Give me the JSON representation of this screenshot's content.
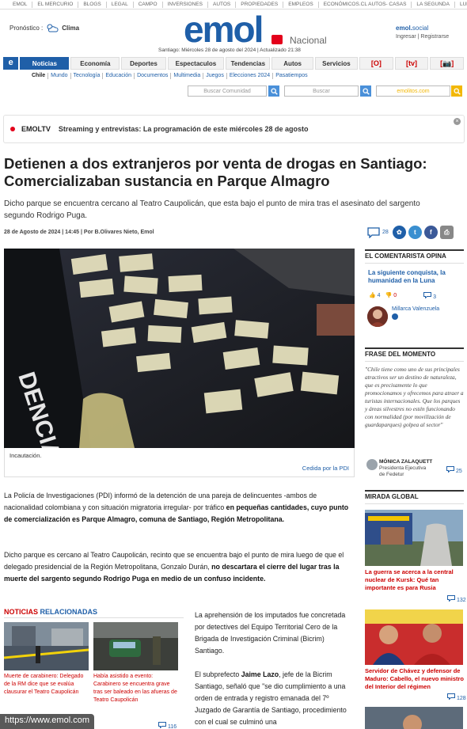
{
  "top_links": [
    "EMOL",
    "EL MERCURIO",
    "BLOGS",
    "LEGAL",
    "CAMPO",
    "INVERSIONES",
    "AUTOS",
    "PROPIEDADES",
    "EMPLEOS",
    "ECONÓMICOS.CL AUTOS- CASAS",
    "LA SEGUNDA",
    "LUN"
  ],
  "header": {
    "forecast_label": "Pronóstico :",
    "forecast_link": "Clima",
    "logo": "emol",
    "section": "Nacional",
    "dateline": "Santiago: Miércoles 28 de agosto del 2024 | Actualizado 21:38",
    "social_brand": "emol.",
    "social_word": "social",
    "login": "Ingresar | Registrarse"
  },
  "nav": {
    "tabs": [
      "Noticias",
      "Economía",
      "Deportes",
      "Espectaculos",
      "Tendencias",
      "Autos",
      "Servicios"
    ],
    "icon_tabs": [
      "[O]",
      "[tv]",
      "[📷]"
    ],
    "subnav": [
      "Chile",
      "Mundo",
      "Tecnología",
      "Educación",
      "Documentos",
      "Multimedia",
      "Juegos",
      "Elecciones 2024",
      "Pasatiempos"
    ]
  },
  "search": {
    "community_placeholder": "Buscar Comunidad",
    "news_placeholder": "Buscar",
    "brand_placeholder": "emolitos.com"
  },
  "banner": {
    "label": "EMOLTV",
    "text": "Streaming y entrevistas: La programación de este miércoles 28 de agosto"
  },
  "article": {
    "title": "Detienen a dos extranjeros por venta de drogas en Santiago: Comercializaban sustancia en Parque Almagro",
    "lead": "Dicho parque se encuentra cercano al Teatro Caupolicán, que esta bajo el punto de mira tras el asesinato del sargento segundo Rodrigo Puga.",
    "byline": "28 de Agosto de 2024 | 14:45 | Por B.Olivares Nieto, Emol",
    "comments": "28",
    "photo_caption": "Incautación.",
    "photo_credit": "Cedida por la PDI",
    "p1_a": "La Policía de Investigaciones (PDI) informó de la detención de una pareja de delincuentes -ambos de nacionalidad colombiana y con situación migratoria irregular- por tráfico ",
    "p1_b": "en pequeñas cantidades, cuyo punto de comercialización es Parque Almagro, comuna de Santiago, Región Metropolitana.",
    "p2_a": "Dicho parque es cercano al Teatro Caupolicán, recinto que se encuentra bajo el punto de mira luego de que el delegado presidencial de la Región Metropolitana, Gonzalo Durán, ",
    "p2_b": "no descartara el cierre del lugar tras la muerte del sargento segundo Rodrigo Puga en medio de un confuso incidente.",
    "p3": "La aprehensión de los imputados fue concretada por detectives del Equipo Territorial Cero de la Brigada de Investigación Criminal (Bicrim) Santiago.",
    "p4_a": "El subprefecto ",
    "p4_b": "Jaime Lazo",
    "p4_c": ", jefe de la Bicrim Santiago, señaló que \"se dio cumplimiento a una orden de entrada y registro emanada del 7º Juzgado de Garantía de Santiago, procedimiento con el cual se culminó una"
  },
  "related": {
    "heading_a": "NOTICIAS",
    "heading_b": " RELACIONADAS",
    "items": [
      {
        "title": "Muerte de carabinero: Delegado de la RM dice que se evalúa clausurar el Teatro Caupolicán",
        "count": ""
      },
      {
        "title": "Había asistido a evento: Carabinero se encuentra grave tras ser baleado en las afueras de Teatro Caupolicán",
        "count": "116"
      }
    ]
  },
  "sidebar": {
    "columnist_heading": "EL COMENTARISTA OPINA",
    "columnist_title": "La siguiente conquista, la humanidad en la Luna",
    "likes": "4",
    "dislikes": "0",
    "comments": "3",
    "author": "Millarca Valenzuela",
    "quote_heading": "FRASE DEL MOMENTO",
    "quote": "\"Chile tiene como uno de sus principales atractivos ser un destino de naturaleza, que es precisamente lo que promocionamos y ofrecemos para atraer a turistas internacionales. Que los parques y áreas silvestres no estén funcionando con normalidad (por movilización de guardaparques) golpea al sector\"",
    "quote_author": "MÓNICA ZALAQUETT",
    "quote_role1": "Presidenta Ejecutiva",
    "quote_role2": "de Fedetur",
    "quote_count": "25",
    "global_heading": "MIRADA GLOBAL",
    "global": [
      {
        "title": "La guerra se acerca a la central nuclear de Kursk: Qué tan importante es para Rusia",
        "count": "132"
      },
      {
        "title": "Servidor de Chávez y defensor de Maduro: Cabello, el nuevo ministro del Interior del régimen",
        "count": "128"
      }
    ]
  },
  "status_url": "https://www.emol.com",
  "colors": {
    "brand_blue": "#1f5fa8",
    "accent_red": "#e3001b",
    "link_red": "#cc0000"
  }
}
